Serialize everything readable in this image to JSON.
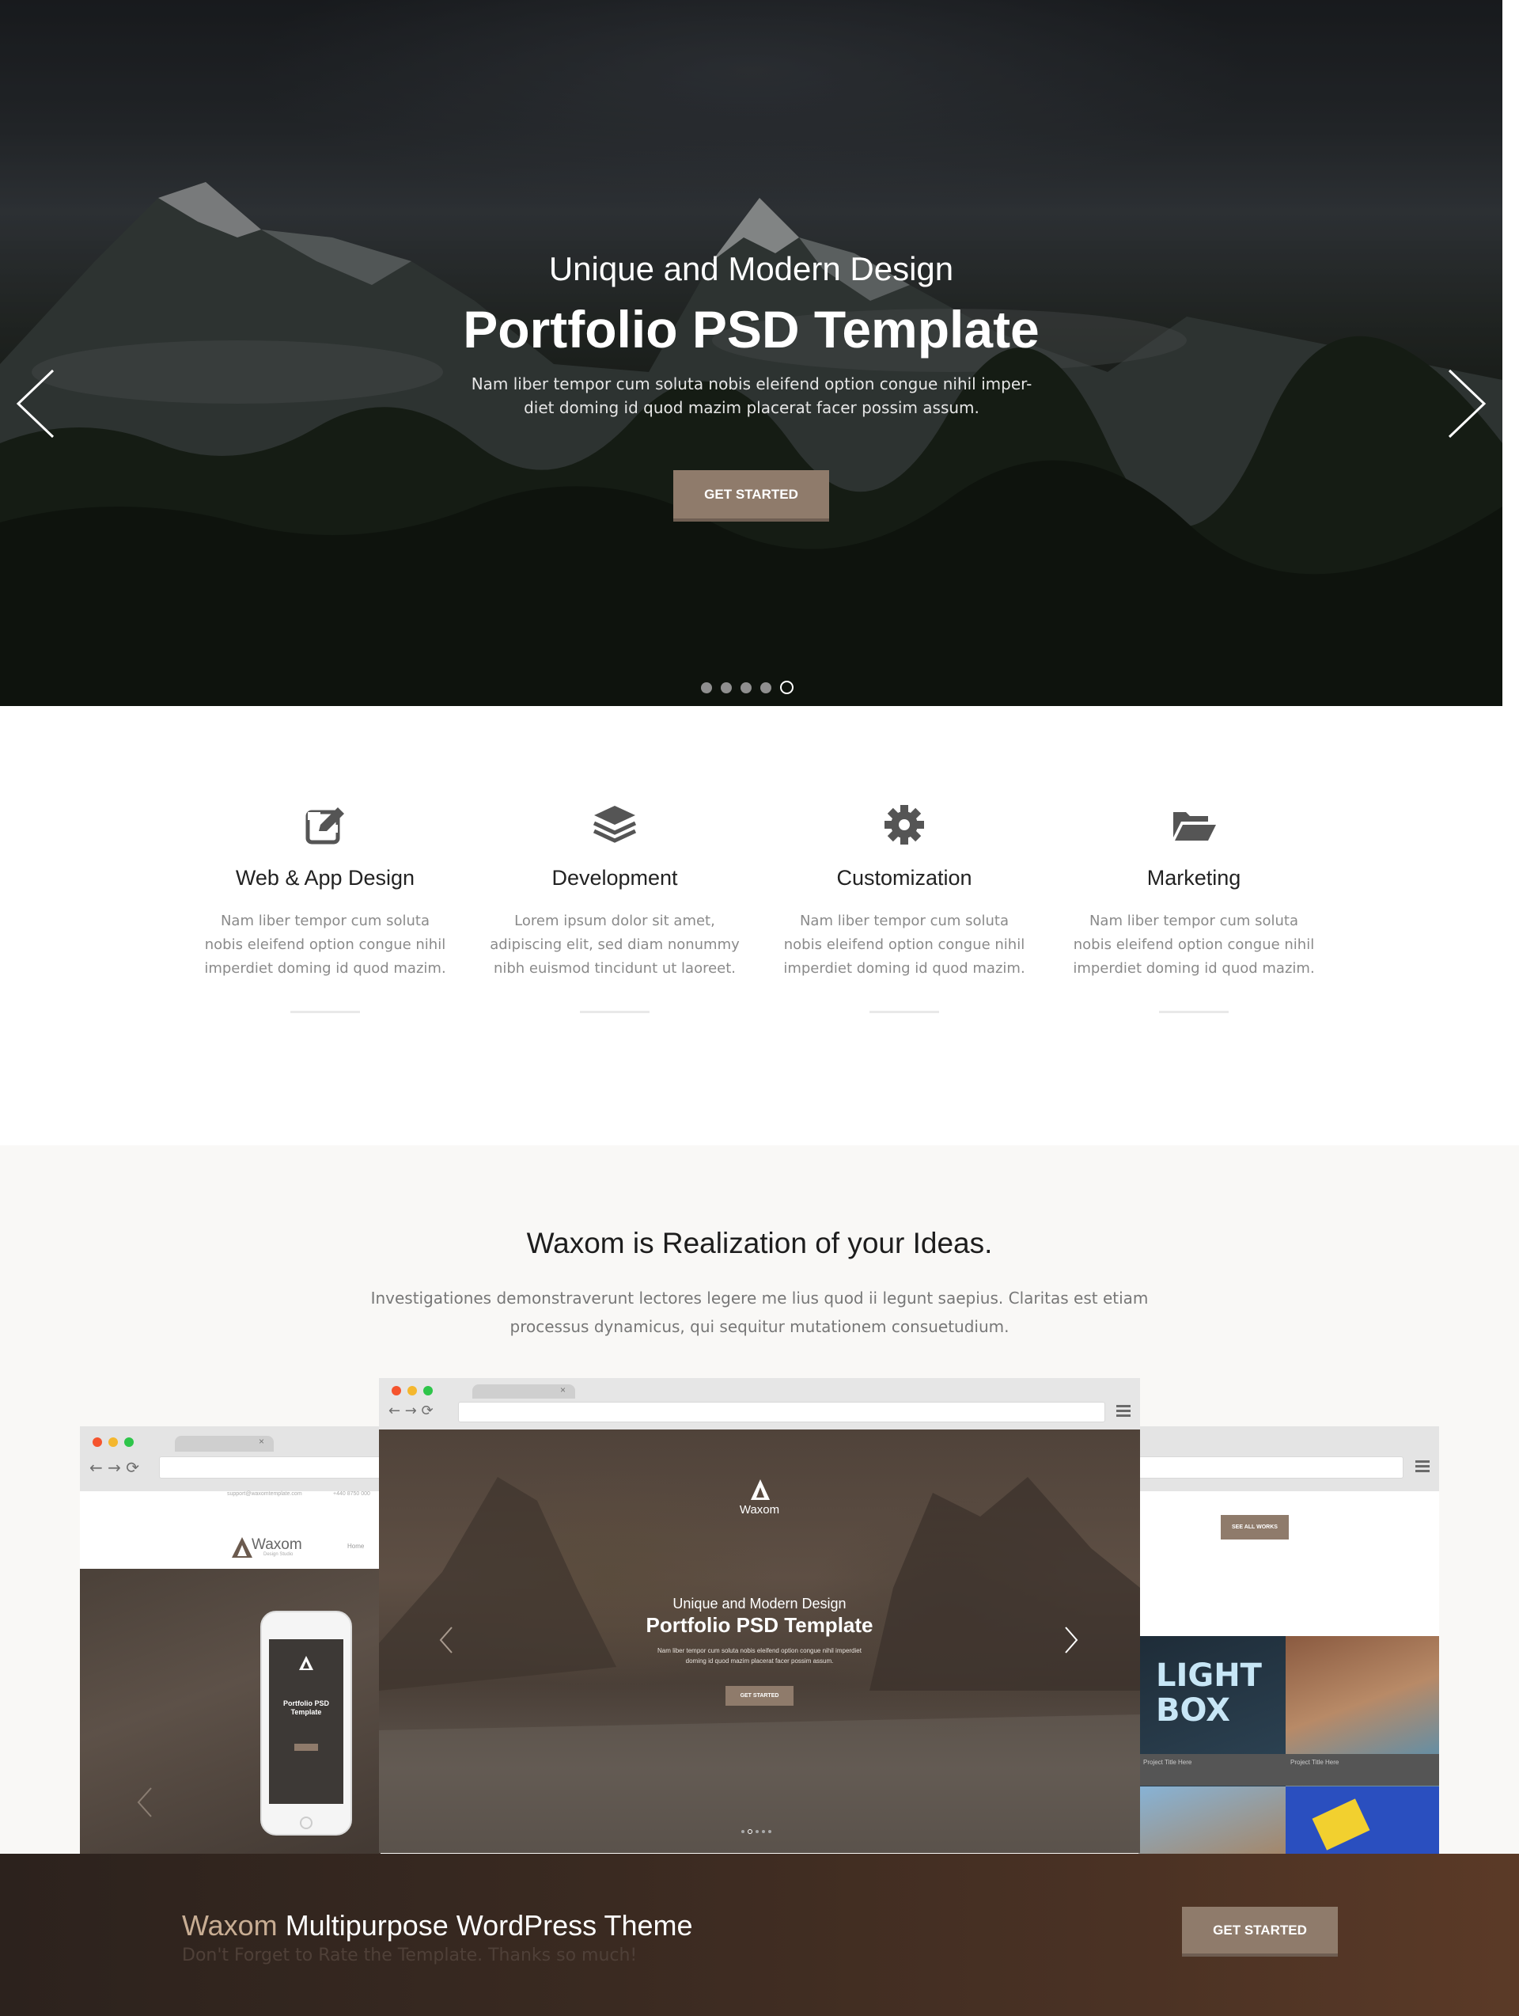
{
  "hero": {
    "subtitle": "Unique and Modern Design",
    "title": "Portfolio PSD Template",
    "text": "Nam liber tempor cum soluta nobis eleifend option congue nihil imper- diet doming id quod mazim placerat facer possim assum.",
    "button_label": "GET STARTED",
    "slider": {
      "slides": 5,
      "active_index": 4
    },
    "arrow_left_icon": "chevron-left-icon",
    "arrow_right_icon": "chevron-right-icon"
  },
  "services": [
    {
      "icon": "edit-icon",
      "title": "Web & App Design",
      "text": "Nam liber tempor cum soluta nobis eleifend option congue nihil imperdiet doming id quod mazim."
    },
    {
      "icon": "layers-icon",
      "title": "Development",
      "text": "Lorem ipsum dolor sit amet, adipiscing elit, sed diam nonummy nibh euismod tincidunt ut laoreet."
    },
    {
      "icon": "gear-icon",
      "title": "Customization",
      "text": "Nam liber tempor cum soluta nobis eleifend option congue nihil imperdiet doming id quod mazim."
    },
    {
      "icon": "folder-open-icon",
      "title": "Marketing",
      "text": "Nam liber tempor cum soluta nobis eleifend option congue nihil imperdiet doming id quod mazim."
    }
  ],
  "ideas": {
    "title": "Waxom is Realization of your Ideas.",
    "text": "Investigationes demonstraverunt lectores legere me lius quod ii legunt saepius. Claritas est etiam processus dynamicus, qui sequitur mutationem consuetudium."
  },
  "mockups": {
    "center": {
      "logo_name": "Waxom",
      "subtitle": "Unique and Modern Design",
      "title": "Portfolio PSD Template",
      "text": "Nam liber tempor cum soluta nobis eleifend option congue nihil imperdiet doming id quod mazim placerat facer possim assum.",
      "button_label": "GET STARTED"
    },
    "left": {
      "email": "support@waxomtemplate.com",
      "phone": "+440 8750 000",
      "brand": "Waxom",
      "brand_sub": "Design Studio",
      "nav_home": "Home",
      "phone_title": "Portfolio PSD Template"
    },
    "right": {
      "button_label": "SEE ALL WORKS",
      "tile_light": "LIGHT BOX",
      "project_label_1": "Project Title Here",
      "project_label_2": "Project Title Here"
    }
  },
  "cta": {
    "brand": "Waxom",
    "title_rest": " Multipurpose WordPress Theme",
    "subtitle": "Don't Forget to Rate the Template. Thanks so much!",
    "button_label": "GET STARTED"
  },
  "colors": {
    "accent": "#8f7b6b",
    "brand_tint": "#c8ad93",
    "cta_bg": "#3a2a21"
  }
}
